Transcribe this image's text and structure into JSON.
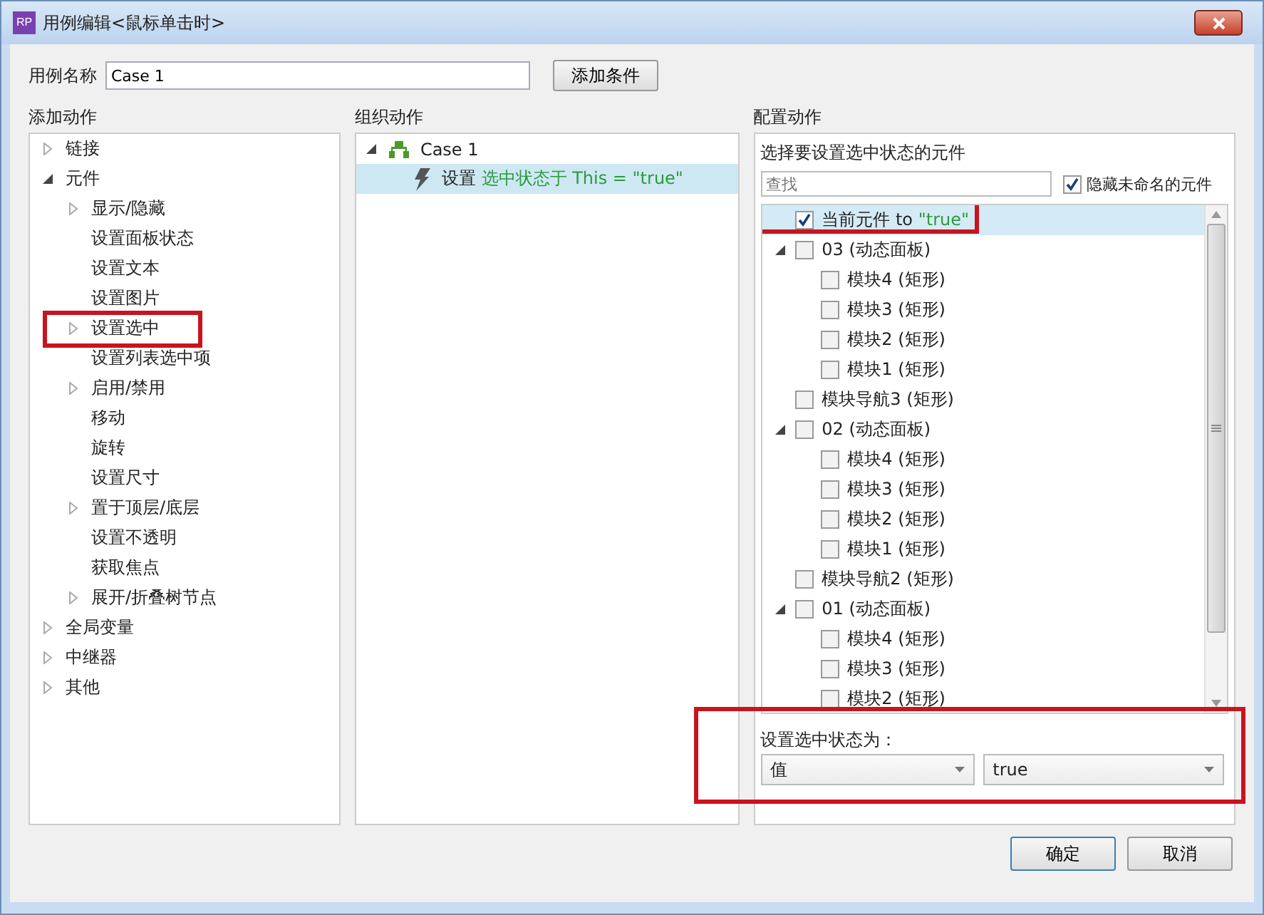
{
  "window": {
    "title": "用例编辑<鼠标单击时>",
    "icon_text": "RP"
  },
  "case_name": {
    "label": "用例名称",
    "value": "Case 1"
  },
  "add_condition_button": "添加条件",
  "add_actions": {
    "heading": "添加动作",
    "tree": [
      {
        "label": "链接",
        "kind": "folder",
        "expanded": false,
        "highlighted": false
      },
      {
        "label": "元件",
        "kind": "folder",
        "expanded": true,
        "highlighted": false,
        "children": [
          {
            "label": "显示/隐藏",
            "kind": "folder",
            "expanded": false,
            "highlighted": false
          },
          {
            "label": "设置面板状态",
            "kind": "leaf",
            "highlighted": false
          },
          {
            "label": "设置文本",
            "kind": "leaf",
            "highlighted": false
          },
          {
            "label": "设置图片",
            "kind": "leaf",
            "highlighted": false
          },
          {
            "label": "设置选中",
            "kind": "folder",
            "expanded": false,
            "highlighted": true
          },
          {
            "label": "设置列表选中项",
            "kind": "leaf",
            "highlighted": false
          },
          {
            "label": "启用/禁用",
            "kind": "folder",
            "expanded": false,
            "highlighted": false
          },
          {
            "label": "移动",
            "kind": "leaf",
            "highlighted": false
          },
          {
            "label": "旋转",
            "kind": "leaf",
            "highlighted": false
          },
          {
            "label": "设置尺寸",
            "kind": "leaf",
            "highlighted": false
          },
          {
            "label": "置于顶层/底层",
            "kind": "folder",
            "expanded": false,
            "highlighted": false
          },
          {
            "label": "设置不透明",
            "kind": "leaf",
            "highlighted": false
          },
          {
            "label": "获取焦点",
            "kind": "leaf",
            "highlighted": false
          },
          {
            "label": "展开/折叠树节点",
            "kind": "folder",
            "expanded": false,
            "highlighted": false
          }
        ]
      },
      {
        "label": "全局变量",
        "kind": "folder",
        "expanded": false,
        "highlighted": false
      },
      {
        "label": "中继器",
        "kind": "folder",
        "expanded": false,
        "highlighted": false
      },
      {
        "label": "其他",
        "kind": "folder",
        "expanded": false,
        "highlighted": false
      }
    ]
  },
  "organize_actions": {
    "heading": "组织动作",
    "cases": [
      {
        "name": "Case 1",
        "expanded": true,
        "actions": [
          {
            "verb": "设置",
            "detail": "选中状态于 This = \"true\"",
            "selected": true
          }
        ]
      }
    ]
  },
  "configure_actions": {
    "heading": "配置动作",
    "prompt": "选择要设置选中状态的元件",
    "search": {
      "placeholder": "查找"
    },
    "hide_unnamed": {
      "label": "隐藏未命名的元件",
      "checked": true
    },
    "widgets": [
      {
        "label": "当前元件 to",
        "value": "\"true\"",
        "checked": true,
        "selected": true,
        "highlighted": true
      },
      {
        "label": "03 (动态面板)",
        "checked": false,
        "selected": false,
        "highlighted": false,
        "expanded": true,
        "children": [
          {
            "label": "模块4 (矩形)",
            "checked": false,
            "selected": false,
            "highlighted": false
          },
          {
            "label": "模块3 (矩形)",
            "checked": false,
            "selected": false,
            "highlighted": false
          },
          {
            "label": "模块2 (矩形)",
            "checked": false,
            "selected": false,
            "highlighted": false
          },
          {
            "label": "模块1 (矩形)",
            "checked": false,
            "selected": false,
            "highlighted": false
          }
        ]
      },
      {
        "label": "模块导航3 (矩形)",
        "checked": false,
        "selected": false,
        "highlighted": false
      },
      {
        "label": "02 (动态面板)",
        "checked": false,
        "selected": false,
        "highlighted": false,
        "expanded": true,
        "children": [
          {
            "label": "模块4 (矩形)",
            "checked": false,
            "selected": false,
            "highlighted": false
          },
          {
            "label": "模块3 (矩形)",
            "checked": false,
            "selected": false,
            "highlighted": false
          },
          {
            "label": "模块2 (矩形)",
            "checked": false,
            "selected": false,
            "highlighted": false
          },
          {
            "label": "模块1 (矩形)",
            "checked": false,
            "selected": false,
            "highlighted": false
          }
        ]
      },
      {
        "label": "模块导航2 (矩形)",
        "checked": false,
        "selected": false,
        "highlighted": false
      },
      {
        "label": "01 (动态面板)",
        "checked": false,
        "selected": false,
        "highlighted": false,
        "expanded": true,
        "children": [
          {
            "label": "模块4 (矩形)",
            "checked": false,
            "selected": false,
            "highlighted": false
          },
          {
            "label": "模块3 (矩形)",
            "checked": false,
            "selected": false,
            "highlighted": false
          },
          {
            "label": "模块2 (矩形)",
            "checked": false,
            "selected": false,
            "highlighted": false
          }
        ]
      }
    ],
    "value_section": {
      "label": "设置选中状态为：",
      "highlighted": true,
      "mode": "值",
      "value": "true"
    }
  },
  "buttons": [
    {
      "label": "确定",
      "default": true
    },
    {
      "label": "取消",
      "default": false
    }
  ]
}
